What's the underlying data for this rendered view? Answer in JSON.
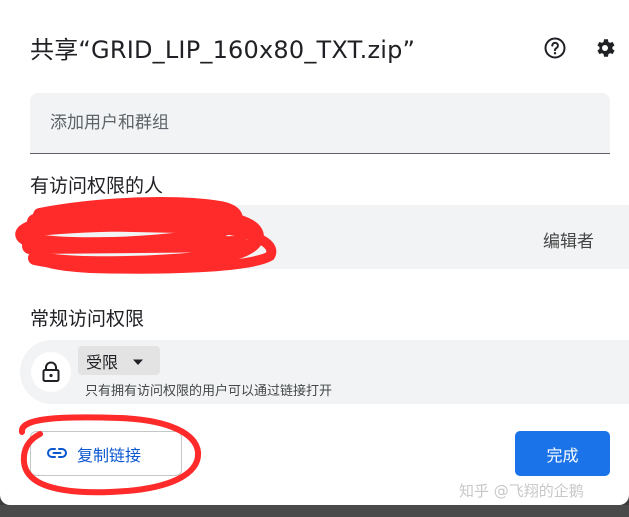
{
  "dialog": {
    "title": "共享“GRID_LIP_160x80_TXT.zip”",
    "help_icon": "help-circle-icon",
    "settings_icon": "gear-icon"
  },
  "add_people": {
    "placeholder": "添加用户和群组",
    "value": ""
  },
  "people_section": {
    "title": "有访问权限的人",
    "entries": [
      {
        "name": "",
        "role": "编辑者"
      }
    ]
  },
  "general_access": {
    "title": "常规访问权限",
    "icon": "lock-icon",
    "selected": "受限",
    "description": "只有拥有访问权限的用户可以通过链接打开"
  },
  "footer": {
    "copy_link_label": "复制链接",
    "copy_link_icon": "link-icon",
    "done_label": "完成"
  },
  "watermark": "知乎 @飞翔的企鹅",
  "colors": {
    "primary": "#1a73e8",
    "link_text": "#0b57d0",
    "field_bg": "#f1f3f4",
    "annotation_red": "#ff2a2a"
  }
}
